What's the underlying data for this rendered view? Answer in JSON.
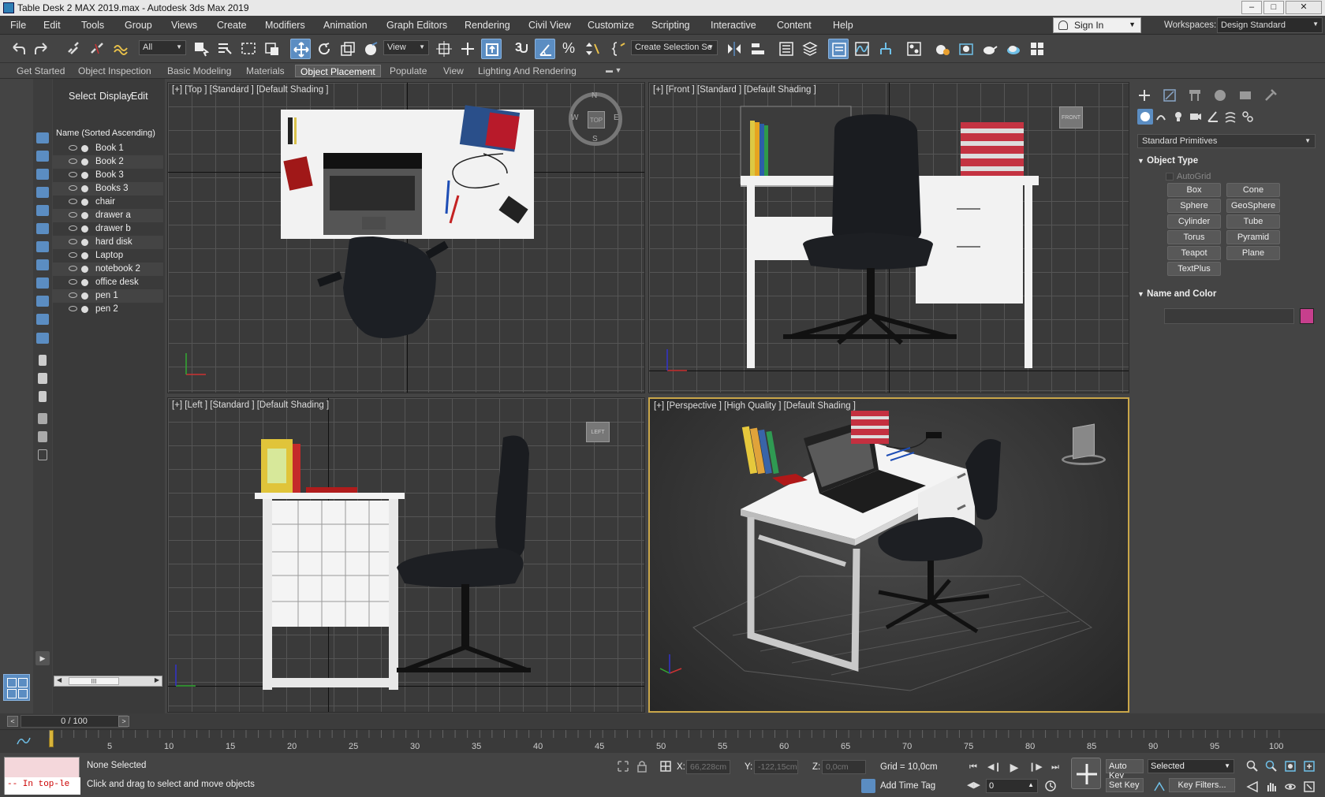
{
  "window": {
    "title": "Table Desk 2 MAX 2019.max - Autodesk 3ds Max 2019"
  },
  "menu": [
    "File",
    "Edit",
    "Tools",
    "Group",
    "Views",
    "Create",
    "Modifiers",
    "Animation",
    "Graph Editors",
    "Rendering",
    "Civil View",
    "Customize",
    "Scripting",
    "Interactive",
    "Content",
    "Help"
  ],
  "account": {
    "sign_in": "Sign In",
    "workspaces_label": "Workspaces:",
    "workspace": "Design Standard"
  },
  "toolbar": {
    "filter": "All",
    "ref_coord": "View",
    "selection_set": "Create Selection Se",
    "snap_angle": "3"
  },
  "ribbon_tabs": [
    "Get Started",
    "Object Inspection",
    "Basic Modeling",
    "Materials",
    "Object Placement",
    "Populate",
    "View",
    "Lighting And Rendering"
  ],
  "ribbon_active": "Object Placement",
  "scene_explorer": {
    "tabs": [
      "Select",
      "Display",
      "Edit"
    ],
    "sort_label": "Name (Sorted Ascending)",
    "items": [
      "Book 1",
      "Book 2",
      "Book 3",
      "Books 3",
      "chair",
      "drawer a",
      "drawer b",
      "hard disk",
      "Laptop",
      "notebook 2",
      "office desk",
      "pen 1",
      "pen 2"
    ],
    "scroll_glyph": "III"
  },
  "viewports": {
    "top": "[+] [Top ] [Standard ] [Default Shading ]",
    "front": "[+] [Front ] [Standard ] [Default Shading ]",
    "left": "[+] [Left ] [Standard ] [Default Shading ]",
    "perspective": "[+] [Perspective ] [High Quality ] [Default Shading ]",
    "viewcube_top": "TOP",
    "viewcube_front": "FRONT",
    "viewcube_left": "LEFT",
    "compass": {
      "n": "N",
      "s": "S",
      "e": "E",
      "w": "W"
    }
  },
  "command_panel": {
    "category": "Standard Primitives",
    "object_type_title": "Object Type",
    "autogrid": "AutoGrid",
    "buttons": [
      "Box",
      "Cone",
      "Sphere",
      "GeoSphere",
      "Cylinder",
      "Tube",
      "Torus",
      "Pyramid",
      "Teapot",
      "Plane",
      "TextPlus"
    ],
    "name_color_title": "Name and Color",
    "color": "#c73f8d"
  },
  "time_slider": {
    "label": "0 / 100"
  },
  "track": {
    "ticks": [
      "5",
      "10",
      "15",
      "20",
      "25",
      "30",
      "35",
      "40",
      "45",
      "50",
      "55",
      "60",
      "65",
      "70",
      "75",
      "80",
      "85",
      "90",
      "95",
      "100"
    ]
  },
  "status": {
    "maxscript": "-- In top-le",
    "selection": "None Selected",
    "prompt": "Click and drag to select and move objects",
    "x_label": "X:",
    "x_val": "66,228cm",
    "y_label": "Y:",
    "y_val": "-122,15cm",
    "z_label": "Z:",
    "z_val": "0,0cm",
    "grid": "Grid = 10,0cm",
    "add_time_tag": "Add Time Tag",
    "auto_key": "Auto Key",
    "set_key": "Set Key",
    "key_mode": "Selected",
    "key_filters": "Key Filters...",
    "frame": "0"
  }
}
